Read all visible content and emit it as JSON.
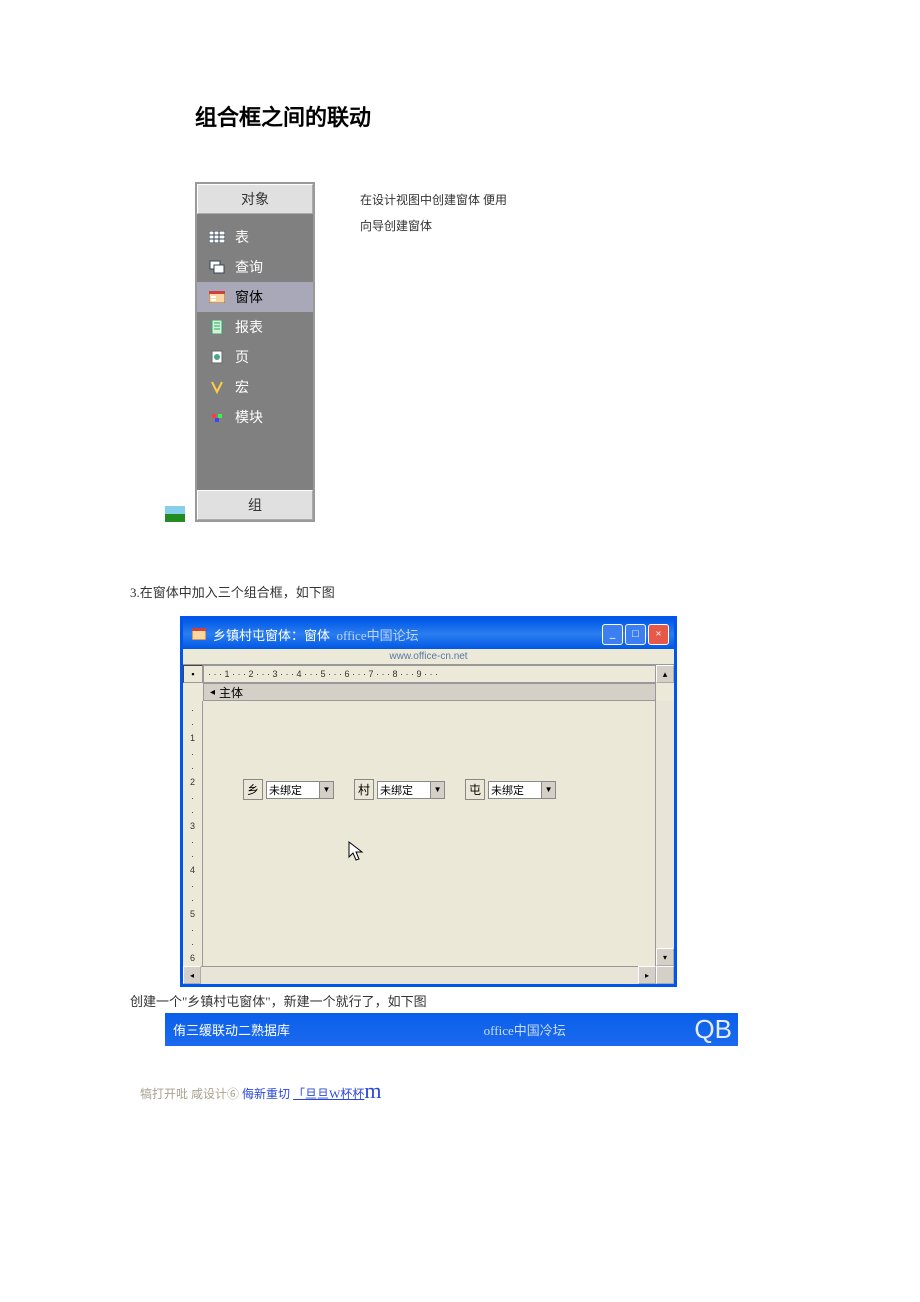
{
  "heading": "组合框之间的联动",
  "navPanel": {
    "header": "对象",
    "items": [
      {
        "label": "表",
        "icon": "table"
      },
      {
        "label": "查询",
        "icon": "query"
      },
      {
        "label": "窗体",
        "icon": "form",
        "selected": true
      },
      {
        "label": "报表",
        "icon": "report"
      },
      {
        "label": "页",
        "icon": "page"
      },
      {
        "label": "宏",
        "icon": "macro"
      },
      {
        "label": "模块",
        "icon": "module"
      }
    ],
    "footer": "组"
  },
  "sideText": {
    "line1": "在设计视图中创建窗体 便用",
    "line2": "向导创建窗体"
  },
  "step3": "3.在窗体中加入三个组合框，如下图",
  "formWindow": {
    "title": "乡镇村屯窗体：窗体",
    "titleSuffix": "office中国论坛",
    "subheader": "www.office-cn.net",
    "rulerH": "· · · 1 · · · 2 · · · 3 · · · 4 · · · 5 · · · 6 · · · 7 · · · 8 · · · 9 · · ·",
    "rulerV": [
      "1",
      "2",
      "3",
      "4",
      "5",
      "6"
    ],
    "sectionLabel": "主体",
    "combos": [
      {
        "label": "乡",
        "value": "未绑定"
      },
      {
        "label": "村",
        "value": "未绑定"
      },
      {
        "label": "屯",
        "value": "未绑定"
      }
    ]
  },
  "caption": "创建一个\"乡镇村屯窗体\"，新建一个就行了，如下图",
  "blueBar": {
    "left": "侑三缓联动二熟据库",
    "mid": "office中国冷坛",
    "right": "QB"
  },
  "footer": {
    "t1": "犒打开吡 咸设计⑥ ",
    "t2": "侮新重切 ",
    "t3": "「旦旦W杯杯",
    "t4": "m"
  }
}
